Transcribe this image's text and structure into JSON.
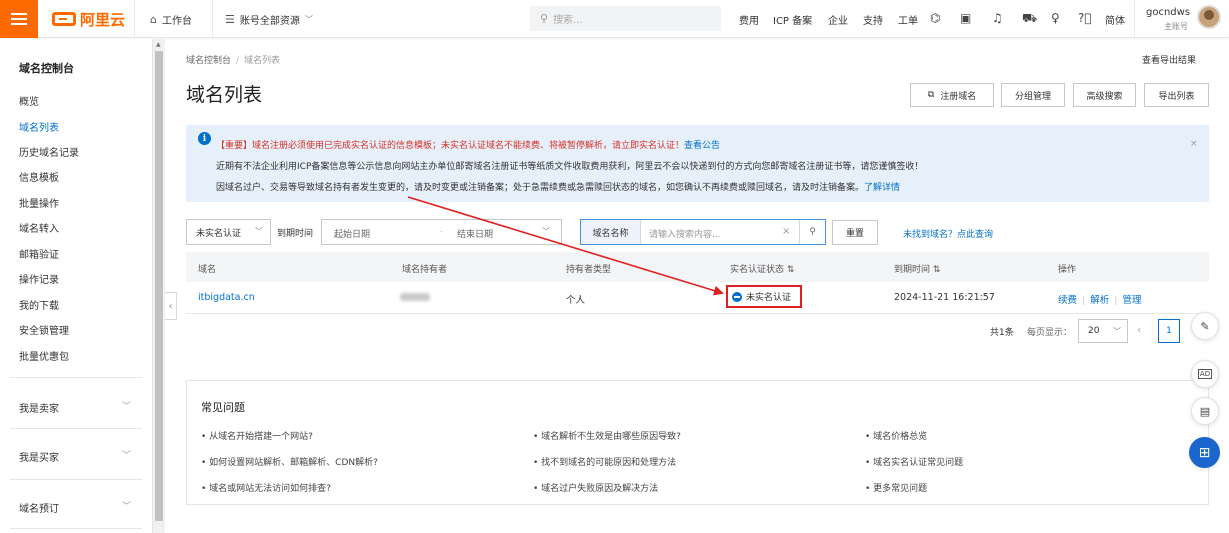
{
  "topbar": {
    "logo_text": "阿里云",
    "workbench": "工作台",
    "resources": "账号全部资源",
    "search_placeholder": "搜索...",
    "nav": [
      "费用",
      "ICP 备案",
      "企业",
      "支持",
      "工单"
    ],
    "lang": "简体",
    "account_name": "gocndws",
    "account_sub": "主账号"
  },
  "sidebar": {
    "title": "域名控制台",
    "items": [
      "概览",
      "域名列表",
      "历史域名记录",
      "信息模板",
      "批量操作",
      "域名转入",
      "邮箱验证",
      "操作记录",
      "我的下载",
      "安全锁管理",
      "批量优惠包"
    ],
    "groups": [
      "我是卖家",
      "我是买家",
      "域名预订"
    ]
  },
  "main": {
    "breadcrumb": [
      "域名控制台",
      "域名列表"
    ],
    "export_results": "查看导出结果",
    "title": "域名列表",
    "buttons": {
      "register": "注册域名",
      "group": "分组管理",
      "advanced": "高级搜索",
      "export": "导出列表"
    },
    "notice": {
      "line1_red": "【重要】域名注册必须使用已完成实名认证的信息模板；未实名认证域名不能续费、将被暂停解析，请立即实名认证！",
      "line1_link": "查看公告",
      "line2": "近期有不法企业利用ICP备案信息等公示信息向网站主办单位邮寄域名注册证书等纸质文件收取费用获利，阿里云不会以快递到付的方式向您邮寄域名注册证书等，请您谨慎签收！",
      "line3": "因域名过户、交易等导致域名持有者发生变更的，请及时变更或注销备案；处于急需续费或急需赎回状态的域名，如您确认不再续费或赎回域名，请及时注销备案。",
      "line3_link": "了解详情",
      "close": "×"
    },
    "filters": {
      "status": "未实名认证",
      "expire_label": "到期时间",
      "start_date": "起始日期",
      "end_date": "结束日期",
      "search_category": "域名名称",
      "search_placeholder": "请输入搜索内容...",
      "reset": "重置",
      "not_found": "未找到域名？点此查询"
    },
    "table": {
      "headers": [
        "域名",
        "域名持有者",
        "持有者类型",
        "实名认证状态 ⇅",
        "到期时间 ⇅",
        "操作"
      ],
      "rows": [
        {
          "domain": "itbigdata.cn",
          "owner_type": "个人",
          "status": "未实名认证",
          "expire": "2024-11-21 16:21:57",
          "ops": [
            "续费",
            "解析",
            "管理"
          ]
        }
      ]
    },
    "pager": {
      "total": "共1条",
      "page_size_label": "每页显示：",
      "page_size": "20",
      "current": "1"
    },
    "faq": {
      "title": "常见问题",
      "items": [
        "• 从域名开始搭建一个网站?",
        "• 域名解析不生效是由哪些原因导致?",
        "• 域名价格总览",
        "• 如何设置网站解析、邮箱解析、CDN解析?",
        "• 找不到域名的可能原因和处理方法",
        "• 域名实名认证常见问题",
        "• 域名或网站无法访问如何排查?",
        "• 域名过户失败原因及解决方法",
        "• 更多常见问题"
      ]
    }
  },
  "colors": {
    "brand": "#ff6a00",
    "link": "#0070cc",
    "highlight": "#e02020"
  }
}
